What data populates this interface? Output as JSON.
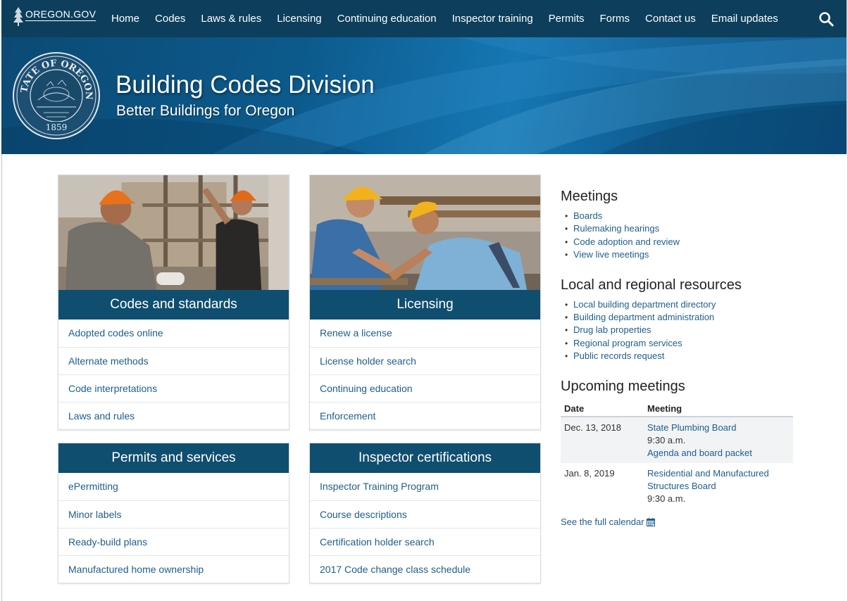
{
  "nav": {
    "logo_text": "OREGON.GOV",
    "items": [
      "Home",
      "Codes",
      "Laws & rules",
      "Licensing",
      "Continuing education",
      "Inspector training",
      "Permits",
      "Forms",
      "Contact us",
      "Email updates"
    ]
  },
  "hero": {
    "title": "Building Codes Division",
    "subtitle": "Better Buildings for Oregon",
    "seal": {
      "top": "OF",
      "left": "STATE",
      "right": "OREGON",
      "year": "1859"
    }
  },
  "cards": [
    {
      "title": "Codes and standards",
      "links": [
        "Adopted codes online",
        "Alternate methods",
        "Code interpretations",
        "Laws and rules"
      ]
    },
    {
      "title": "Licensing",
      "links": [
        "Renew a license",
        "License holder search",
        "Continuing education",
        "Enforcement"
      ]
    },
    {
      "title": "Permits and services",
      "links": [
        "ePermitting",
        "Minor labels",
        "Ready-build plans",
        "Manufactured home ownership"
      ]
    },
    {
      "title": "Inspector certifications",
      "links": [
        "Inspector Training Program",
        "Course descriptions",
        "Certification holder search",
        "2017 Code change class schedule"
      ]
    }
  ],
  "meetings": {
    "heading": "Meetings",
    "items": [
      "Boards",
      "Rulemaking hearings",
      "Code adoption and review",
      "View live meetings"
    ]
  },
  "resources": {
    "heading": "Local and regional resources",
    "items": [
      "Local building department directory",
      "Building department administration",
      "Drug lab properties",
      "Regional program services",
      "Public records request"
    ]
  },
  "upcoming": {
    "heading": "Upcoming meetings",
    "col_date": "Date",
    "col_meeting": "Meeting",
    "rows": [
      {
        "date": "Dec. 13, 2018",
        "name": "State Plumbing Board",
        "time": "9:30 a.m.",
        "extra": "Agenda and board packet"
      },
      {
        "date": "Jan. 8, 2019",
        "name": "Residential and Manufactured Structures Board",
        "time": "9:30 a.m.",
        "extra": ""
      }
    ],
    "full_calendar": "See the full calendar"
  },
  "colors": {
    "nav_bg": "#0d3f5c",
    "card_header": "#0f4e6f",
    "link": "#1d5e8c"
  }
}
